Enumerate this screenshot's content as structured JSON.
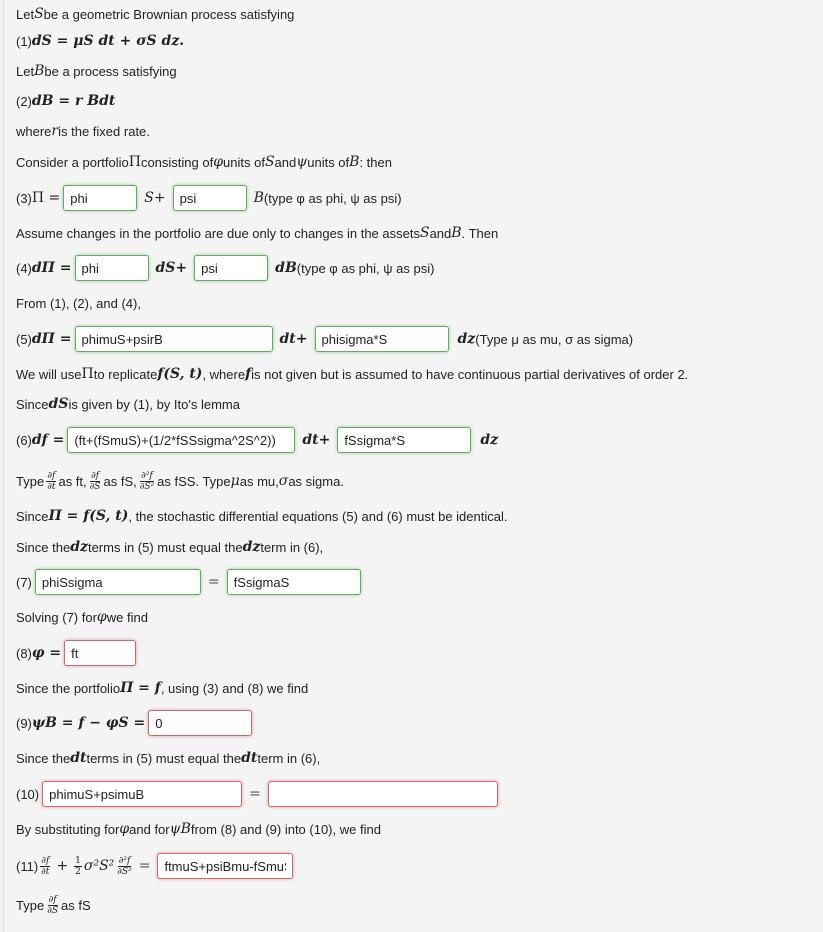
{
  "intro": {
    "line1": [
      "Let ",
      "S",
      " be a geometric Brownian process satisfying"
    ],
    "eq1": {
      "label": "(1) ",
      "math": "dS = μS dt + σS dz."
    },
    "line2": [
      "Let ",
      "B",
      " be a process satisfying"
    ],
    "eq2": {
      "label": "(2) ",
      "math": "dB = r Bdt"
    },
    "line3": [
      "where ",
      "r",
      " is the fixed rate."
    ]
  },
  "portfolio_text": {
    "a": "Consider a portfolio ",
    "pi": "Π",
    "b": " consisting of ",
    "phi": "φ",
    "c": " units of ",
    "S": "S",
    "d": " and ",
    "psi": "ψ",
    "e": " units of ",
    "B": "B",
    "f": ": then"
  },
  "eq3": {
    "label": "(3) ",
    "lhs": "Π =",
    "mid": "S+",
    "end": "B",
    "hint": " (type φ as phi, ψ as psi)",
    "fields": [
      {
        "value": "phi",
        "status": "correct"
      },
      {
        "value": "psi",
        "status": "correct"
      }
    ]
  },
  "assume_text": {
    "a": "Assume changes in the portfolio are due only to changes in the assets ",
    "S": "S",
    "b": " and ",
    "B": "B",
    "c": ". Then"
  },
  "eq4": {
    "label": "(4) ",
    "lhs": "dΠ =",
    "mid": "dS+",
    "end": "dB",
    "hint": " (type φ as phi, ψ as psi)",
    "fields": [
      {
        "value": "phi",
        "status": "correct"
      },
      {
        "value": "psi",
        "status": "correct"
      }
    ]
  },
  "from_text": "From (1), (2), and (4),",
  "eq5": {
    "label": "(5) ",
    "lhs": "dΠ =",
    "mid": "dt+",
    "end": "dz",
    "hint": " (Type μ as mu, σ as sigma)",
    "fields": [
      {
        "value": "phimuS+psirB",
        "status": "correct"
      },
      {
        "value": "phisigma*S",
        "status": "correct"
      }
    ]
  },
  "replicate_text": {
    "a": "We will use ",
    "pi": "Π",
    "b": " to replicate ",
    "fst": "f(S, t)",
    "c": ", where ",
    "f": "f",
    "d": " is not given but is assumed to have continuous partial derivatives of order 2."
  },
  "ito_text": {
    "a": "Since ",
    "dS": "dS",
    "b": " is given by (1), by Ito's lemma"
  },
  "eq6": {
    "label": "(6) ",
    "lhs": "df =",
    "mid": "dt+",
    "end": "dz",
    "fields": [
      {
        "value": "(ft+(fSmuS)+(1/2*fSSsigma^2S^2))",
        "status": "correct"
      },
      {
        "value": "fSsigma*S",
        "status": "correct"
      }
    ]
  },
  "type_hint6": {
    "a": "Type ",
    "ft_num": "∂f",
    "ft_den": "∂t",
    "b": " as ft, ",
    "fS_num": "∂f",
    "fS_den": "∂S",
    "c": " as fS, ",
    "fSS_num": "∂²f",
    "fSS_den": "∂S²",
    "d": " as fSS. Type ",
    "mu": "μ",
    "e": " as mu, ",
    "sigma": "σ",
    "f": " as sigma."
  },
  "since_pi_text": {
    "a": "Since ",
    "math": "Π = f(S, t)",
    "b": ", the stochastic differential equations (5) and (6) must be identical."
  },
  "dz_text": {
    "a": "Since the ",
    "dz1": "dz",
    "b": " terms in (5) must equal the ",
    "dz2": "dz",
    "c": " term in (6),"
  },
  "eq7": {
    "label": "(7) ",
    "eq": "=",
    "fields": [
      {
        "value": "phiSsigma",
        "status": "correct"
      },
      {
        "value": "fSsigmaS",
        "status": "correct"
      }
    ]
  },
  "solving_text": {
    "a": "Solving (7) for ",
    "phi": "φ",
    "b": " we find"
  },
  "eq8": {
    "label": "(8) ",
    "lhs": "φ =",
    "fields": [
      {
        "value": "ft",
        "status": "incorrect"
      }
    ]
  },
  "portfolio_f_text": {
    "a": "Since the portfolio ",
    "math": "Π = f",
    "b": ", using (3) and (8) we find"
  },
  "eq9": {
    "label": "(9) ",
    "lhs": "ψB = f − φS =",
    "fields": [
      {
        "value": "0",
        "status": "incorrect"
      }
    ]
  },
  "dt_text": {
    "a": "Since the ",
    "dt1": "dt",
    "b": " terms in (5) must equal the ",
    "dt2": "dt",
    "c": " term in (6),"
  },
  "eq10": {
    "label": "(10) ",
    "eq": "=",
    "fields": [
      {
        "value": "phimuS+psimuB",
        "status": "incorrect"
      },
      {
        "value": "",
        "status": "incorrect"
      }
    ]
  },
  "subst_text": {
    "a": "By substituting for ",
    "phi": "φ",
    "b": " and for ",
    "psiB": "ψB",
    "c": " from (8) and (9) into (10), we find"
  },
  "eq11": {
    "label": "(11) ",
    "ft_num": "∂f",
    "ft_den": "∂t",
    "plus": "+",
    "half_num": "1",
    "half_den": "2",
    "sig": "σ²S²",
    "fSS_num": "∂²f",
    "fSS_den": "∂S²",
    "eq": "=",
    "fields": [
      {
        "value": "ftmuS+psiBmu-fSmuS",
        "status": "incorrect"
      }
    ]
  },
  "type_hint11": {
    "a": "Type ",
    "num": "∂f",
    "den": "∂S",
    "b": " as fS"
  },
  "colors": {
    "correct": "#6aa86a",
    "incorrect": "#cc6b6b",
    "background": "#f4f4f4"
  }
}
